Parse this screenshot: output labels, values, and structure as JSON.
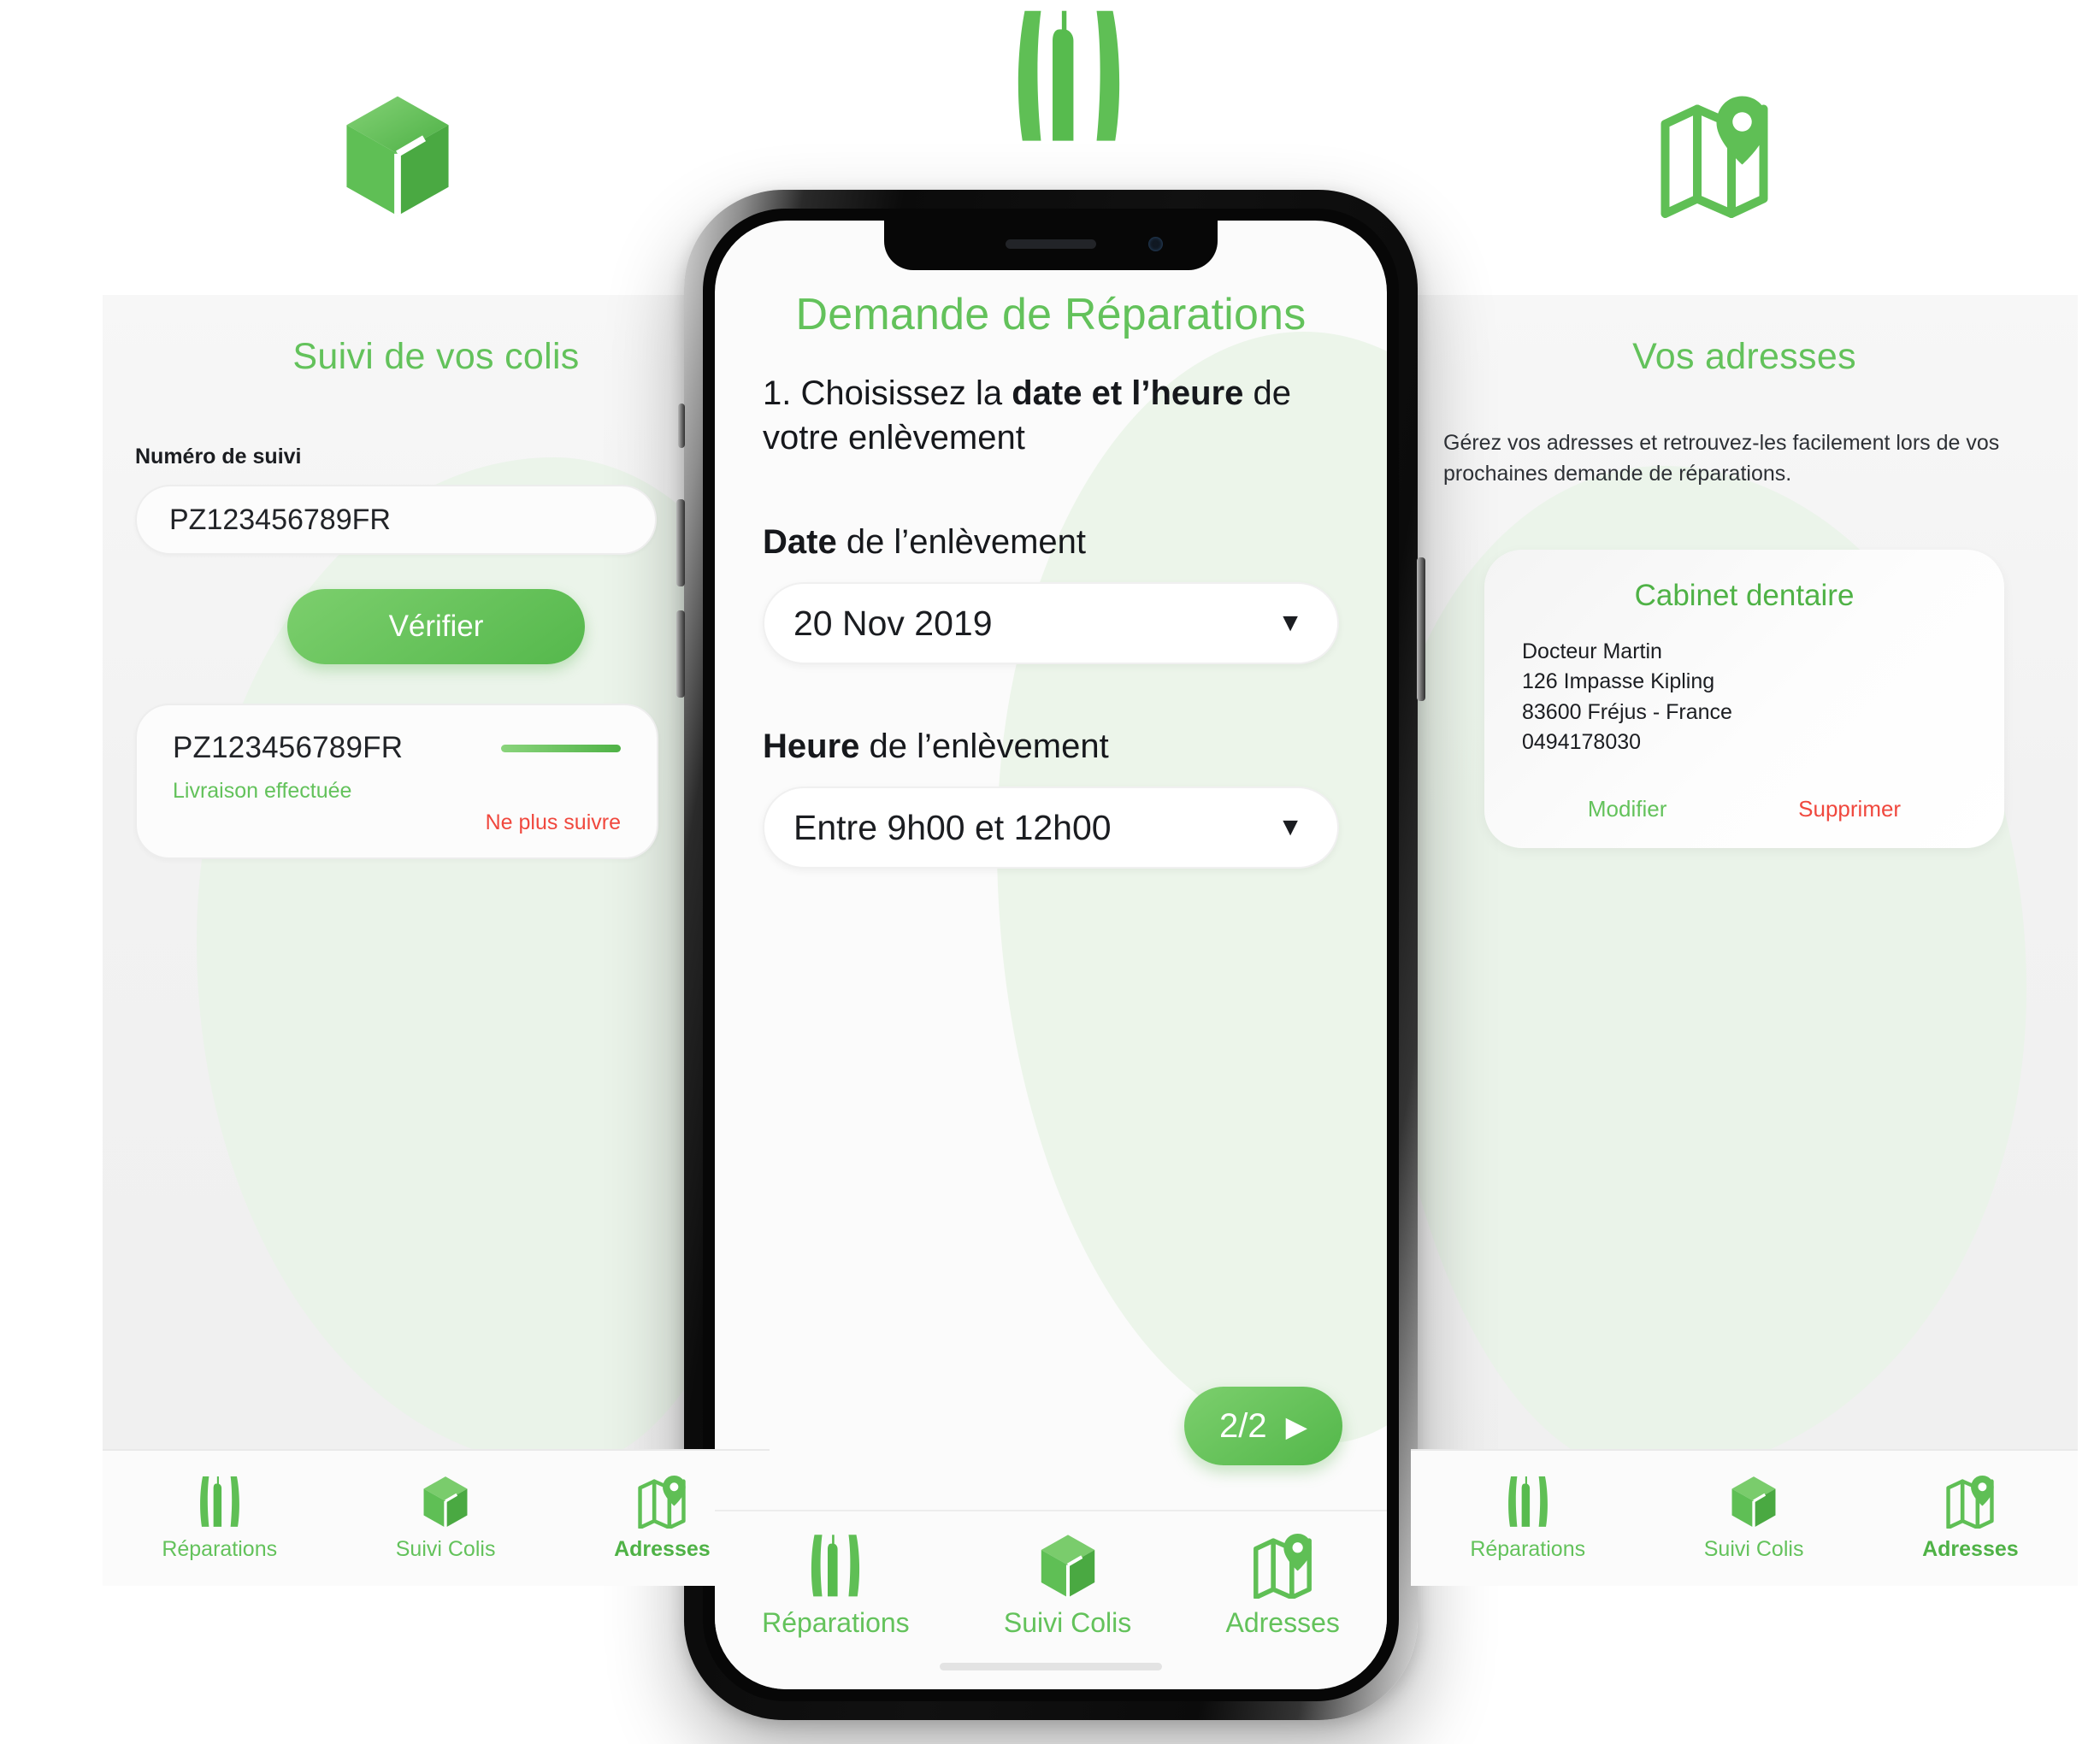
{
  "hero_icons": [
    {
      "name": "package-icon",
      "label": "package"
    },
    {
      "name": "dental-tools-icon",
      "label": "dental tools"
    },
    {
      "name": "map-pin-icon",
      "label": "map"
    }
  ],
  "colors": {
    "brand_green": "#63c25b",
    "brand_green_dark": "#4fb246",
    "danger_red": "#f0483e",
    "text_dark": "#16181c",
    "panel_bg": "#f2f2f2",
    "blob_green": "#e9f3e7"
  },
  "left_panel": {
    "title": "Suivi de vos colis",
    "tracking_label": "Numéro de suivi",
    "tracking_value": "PZ123456789FR",
    "tracking_placeholder": "Numéro de suivi",
    "verify_button": "Vérifier",
    "result": {
      "number": "PZ123456789FR",
      "status": "Livraison effectuée",
      "unfollow": "Ne plus suivre",
      "progress_percent": 100
    },
    "nav": [
      {
        "label": "Réparations",
        "icon": "dental-tools-icon",
        "active": false
      },
      {
        "label": "Suivi Colis",
        "icon": "package-icon",
        "active": false
      },
      {
        "label": "Adresses",
        "icon": "map-pin-icon",
        "active": true
      }
    ]
  },
  "phone": {
    "app_title": "Demande de Réparations",
    "step": {
      "prefix": "1. Choisissez la ",
      "bold": "date et l’heure",
      "suffix": " de votre enlèvement"
    },
    "date_field": {
      "label_bold": "Date",
      "label_rest": " de l’enlèvement",
      "value": "20 Nov 2019",
      "caret": "▼"
    },
    "time_field": {
      "label_bold": "Heure",
      "label_rest": " de l’enlèvement",
      "value": "Entre 9h00 et 12h00",
      "caret": "▼"
    },
    "next_button": {
      "label": "2/2",
      "play": "▶"
    },
    "nav": [
      {
        "label": "Réparations",
        "icon": "dental-tools-icon",
        "active": false
      },
      {
        "label": "Suivi Colis",
        "icon": "package-icon",
        "active": false
      },
      {
        "label": "Adresses",
        "icon": "map-pin-icon",
        "active": false
      }
    ]
  },
  "right_panel": {
    "title": "Vos adresses",
    "description": "Gérez vos adresses et retrouvez-les facilement lors de vos prochaines demande de réparations.",
    "address_card": {
      "title": "Cabinet dentaire",
      "line1": "Docteur Martin",
      "line2": "126 Impasse Kipling",
      "line3": "83600 Fréjus - France",
      "line4": "0494178030",
      "edit_label": "Modifier",
      "delete_label": "Supprimer"
    },
    "nav": [
      {
        "label": "Réparations",
        "icon": "dental-tools-icon",
        "active": false
      },
      {
        "label": "Suivi Colis",
        "icon": "package-icon",
        "active": false
      },
      {
        "label": "Adresses",
        "icon": "map-pin-icon",
        "active": true
      }
    ]
  }
}
